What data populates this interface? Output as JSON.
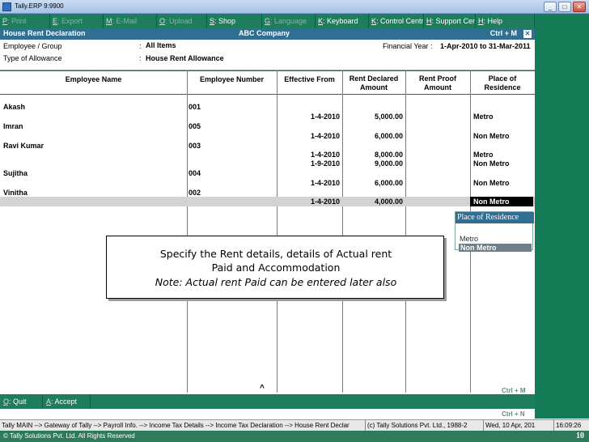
{
  "window": {
    "title": "Tally.ERP 9:9900",
    "minimize": "_",
    "maximize": "□",
    "close": "✕"
  },
  "menu": [
    {
      "key": "P",
      "label": ": Print",
      "active": false,
      "w": 62
    },
    {
      "key": "E",
      "label": ": Export",
      "active": false,
      "w": 66
    },
    {
      "key": "M",
      "label": ": E-Mail",
      "active": false,
      "w": 66
    },
    {
      "key": "O",
      "label": ": Upload",
      "active": false,
      "w": 62
    },
    {
      "key": "S",
      "label": ": Shop",
      "active": true,
      "w": 68
    },
    {
      "key": "G",
      "label": ": Language",
      "active": false,
      "w": 66
    },
    {
      "key": "K",
      "label": ": Keyboard",
      "active": true,
      "w": 66
    },
    {
      "key": "K",
      "label": ": Control Centre",
      "active": true,
      "w": 68
    },
    {
      "key": "H",
      "label": ": Support Centre",
      "active": true,
      "w": 64
    },
    {
      "key": "H",
      "label": ": Help",
      "active": true,
      "w": 73
    }
  ],
  "header": {
    "title": "House Rent Declaration",
    "company": "ABC Company",
    "shortcut": "Ctrl + M",
    "close": "✕"
  },
  "info": {
    "employee_group_label": "Employee / Group",
    "employee_group_value": "All Items",
    "allowance_label": "Type of Allowance",
    "allowance_value": "House Rent Allowance",
    "colon": ":",
    "fy_label": "Financial Year :",
    "fy_value": "1-Apr-2010 to 31-Mar-2011"
  },
  "columns": {
    "employee_name": "Employee Name",
    "employee_number": "Employee Number",
    "effective_from": "Effective From",
    "rent_declared": "Rent Declared",
    "rent_declared_2": "Amount",
    "rent_proof": "Rent Proof",
    "rent_proof_2": "Amount",
    "place": "Place of",
    "place_2": "Residence"
  },
  "employees": [
    {
      "name": "Akash",
      "number": "001"
    },
    {
      "name": "Imran",
      "number": "005"
    },
    {
      "name": "Ravi Kumar",
      "number": "003"
    },
    {
      "name": "Sujitha",
      "number": "004"
    },
    {
      "name": "Vinitha",
      "number": "002"
    }
  ],
  "rent_rows": [
    {
      "date": "1-4-2010",
      "amount": "5,000.00",
      "place": "Metro"
    },
    {
      "date": "1-4-2010",
      "amount": "6,000.00",
      "place": "Non Metro"
    },
    {
      "date": "1-4-2010",
      "amount": "8,000.00",
      "place": "Metro"
    },
    {
      "date": "1-9-2010",
      "amount": "9,000.00",
      "place": "Non Metro"
    },
    {
      "date": "1-4-2010",
      "amount": "6,000.00",
      "place": "Non Metro"
    },
    {
      "date": "1-4-2010",
      "amount": "4,000.00",
      "place": "Non Metro"
    }
  ],
  "place_popup": {
    "title": "Place of Residence",
    "options": [
      "Metro",
      "Non Metro"
    ],
    "selected": "Non Metro"
  },
  "callout": {
    "line1": "Specify the Rent details, details of Actual rent",
    "line2": "Paid and Accommodation",
    "line3": "Note: Actual rent Paid can be entered later also"
  },
  "caret": "^",
  "buttons": [
    {
      "key": "Q",
      "label": ": Quit"
    },
    {
      "key": "A",
      "label": ": Accept"
    }
  ],
  "ctrl_n": "Ctrl + N",
  "status": [
    "Tally MAIN --> Gateway of Tally --> Payroll Info. --> Income Tax Details --> Income Tax Declaration --> House Rent Declar",
    "(c) Tally Solutions Pvt. Ltd., 1988-2",
    "Wed, 10 Apr, 201",
    "16:09:26"
  ],
  "footer": {
    "copyright": "© Tally Solutions Pvt. Ltd. All Rights Reserved",
    "page": "10"
  }
}
